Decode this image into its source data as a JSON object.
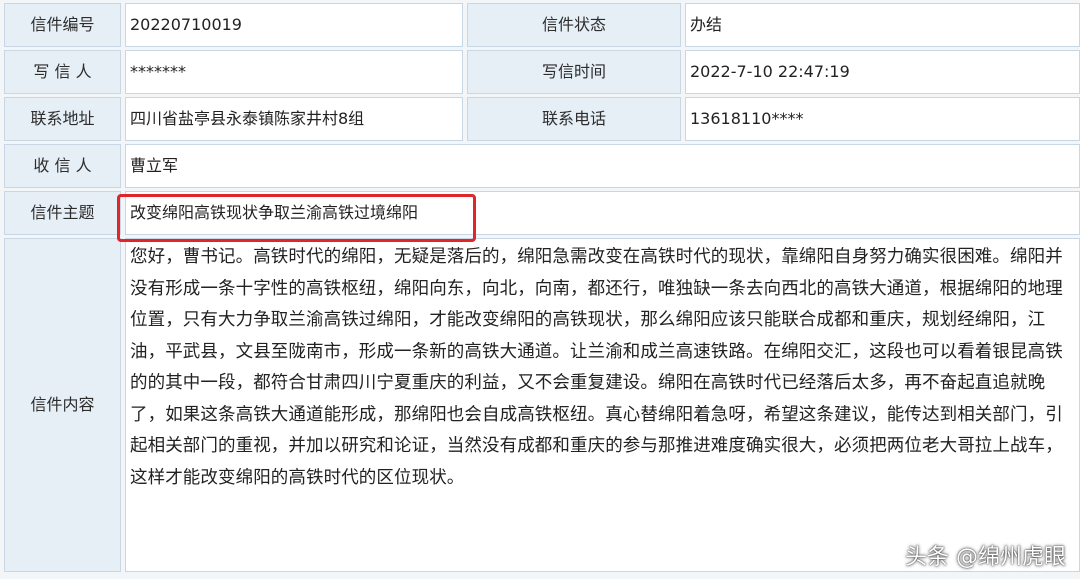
{
  "fields": {
    "letter_no": {
      "label": "信件编号",
      "value": "20220710019"
    },
    "status": {
      "label": "信件状态",
      "value": "办结"
    },
    "writer": {
      "label": "写 信 人",
      "value": "*******"
    },
    "write_time": {
      "label": "写信时间",
      "value": "2022-7-10 22:47:19"
    },
    "address": {
      "label": "联系地址",
      "value": "四川省盐亭县永泰镇陈家井村8组"
    },
    "phone": {
      "label": "联系电话",
      "value": "13618110****"
    },
    "recipient": {
      "label": "收 信 人",
      "value": "曹立军"
    },
    "subject": {
      "label": "信件主题",
      "value": "改变绵阳高铁现状争取兰渝高铁过境绵阳"
    },
    "content": {
      "label": "信件内容",
      "value": "您好，曹书记。高铁时代的绵阳，无疑是落后的，绵阳急需改变在高铁时代的现状，靠绵阳自身努力确实很困难。绵阳并没有形成一条十字性的高铁枢纽，绵阳向东，向北，向南，都还行，唯独缺一条去向西北的高铁大通道，根据绵阳的地理位置，只有大力争取兰渝高铁过绵阳，才能改变绵阳的高铁现状，那么绵阳应该只能联合成都和重庆，规划经绵阳，江油，平武县，文县至陇南市，形成一条新的高铁大通道。让兰渝和成兰高速铁路。在绵阳交汇，这段也可以看着银昆高铁的的其中一段，都符合甘肃四川宁夏重庆的利益，又不会重复建设。绵阳在高铁时代已经落后太多，再不奋起直追就晚了，如果这条高铁大通道能形成，那绵阳也会自成高铁枢纽。真心替绵阳着急呀，希望这条建议，能传达到相关部门，引起相关部门的重视，并加以研究和论证，当然没有成都和重庆的参与那推进难度确实很大，必须把两位老大哥拉上战车，这样才能改变绵阳的高铁时代的区位现状。"
    }
  },
  "watermark": "头条 @绵州虎眼",
  "colors": {
    "label_bg": "#e6eef6",
    "border": "#c9d6e3",
    "highlight": "#e0262a"
  }
}
